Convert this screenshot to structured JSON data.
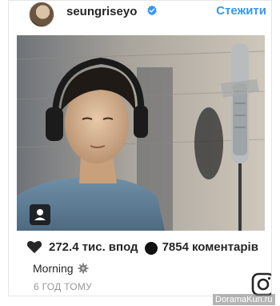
{
  "header": {
    "username": "seungriseyo",
    "follow_label": "Стежити",
    "verified_icon": "verified-badge-icon"
  },
  "photo": {
    "description_icon": "user-tag-icon"
  },
  "stats": {
    "likes_count": "272.4 тис.",
    "likes_label": "впод",
    "comments_count": "7854",
    "comments_label": "коментарів"
  },
  "caption": {
    "text": "Morning",
    "emoji_icon": "gear-icon"
  },
  "timestamp": "6 ГОД ТОМУ",
  "watermark": "DoramaKun.ru",
  "colors": {
    "accent": "#3897f0",
    "text": "#262626",
    "muted": "#999999"
  }
}
